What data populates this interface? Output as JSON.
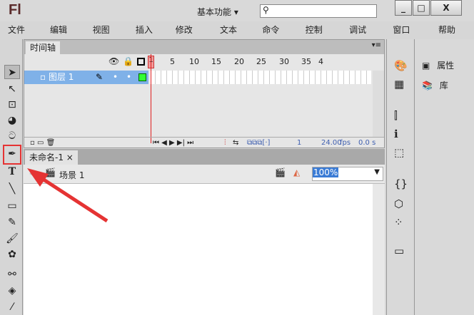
{
  "app": {
    "logo": "Fl",
    "workspace": "基本功能",
    "window_buttons": [
      "_",
      "□",
      "X"
    ]
  },
  "menu": [
    "文件(F)",
    "编辑(E)",
    "视图(V)",
    "插入(I)",
    "修改(M)",
    "文本(T)",
    "命令(C)",
    "控制(O)",
    "调试(D)",
    "窗口(W)",
    "帮助(H)"
  ],
  "timeline": {
    "tab": "时间轴",
    "frame_numbers": [
      "1",
      "5",
      "10",
      "15",
      "20",
      "25",
      "30",
      "35",
      "4"
    ],
    "layer_name": "图层 1",
    "current_frame": "1",
    "fps": "24.00",
    "fps_unit": "fps",
    "time": "0.0 s"
  },
  "document": {
    "tab": "未命名-1",
    "close": "×",
    "scene": "场景 1",
    "zoom": "100%"
  },
  "right_panel": {
    "properties": "属性",
    "library": "库"
  },
  "accent": {
    "highlight": "#e53333",
    "layer": "#7fb1e8"
  }
}
